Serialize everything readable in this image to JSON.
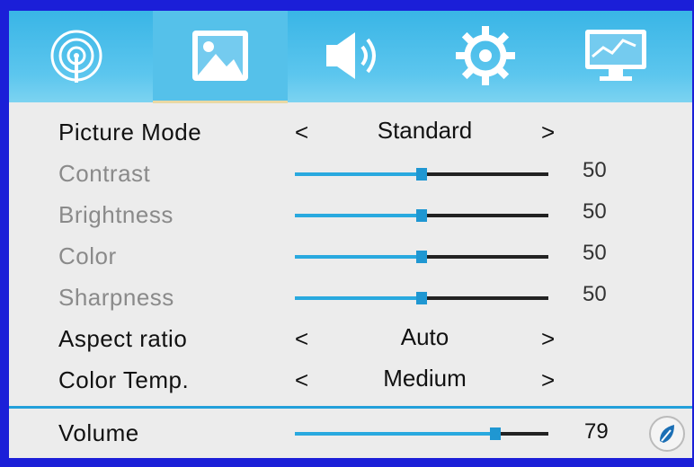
{
  "colors": {
    "accent": "#29a9df",
    "topbar": "#39b5e6",
    "background": "#1b1fd8"
  },
  "tabs": [
    {
      "icon": "signal-source-icon",
      "active": false
    },
    {
      "icon": "picture-icon",
      "active": true
    },
    {
      "icon": "sound-icon",
      "active": false
    },
    {
      "icon": "settings-icon",
      "active": false
    },
    {
      "icon": "monitor-icon",
      "active": false
    }
  ],
  "menu": {
    "picture_mode": {
      "label": "Picture Mode",
      "value": "Standard"
    },
    "contrast": {
      "label": "Contrast",
      "value": "50",
      "level": 0.5
    },
    "brightness": {
      "label": "Brightness",
      "value": "50",
      "level": 0.5
    },
    "color": {
      "label": "Color",
      "value": "50",
      "level": 0.5
    },
    "sharpness": {
      "label": "Sharpness",
      "value": "50",
      "level": 0.5
    },
    "aspect_ratio": {
      "label": "Aspect ratio",
      "value": "Auto"
    },
    "color_temp": {
      "label": "Color Temp.",
      "value": "Medium"
    }
  },
  "arrows": {
    "left": "<",
    "right": ">"
  },
  "volume": {
    "label": "Volume",
    "value": "79",
    "level": 0.79,
    "icon": "volume-knob-icon"
  }
}
